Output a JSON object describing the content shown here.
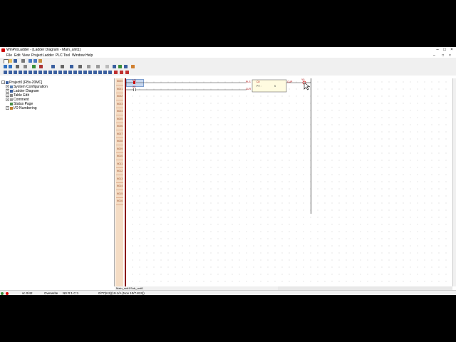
{
  "window": {
    "title": "WinProLadder - [Ladder Diagram - Main_unit1]",
    "controls": [
      "–",
      "□",
      "×"
    ],
    "inner_controls": [
      "–",
      "□",
      "×"
    ]
  },
  "menu": [
    "File",
    "Edit",
    "View",
    "Project",
    "Ladder",
    "PLC",
    "Tool",
    "Window",
    "Help"
  ],
  "tree": {
    "root": "Project0 [FBs-20MC]",
    "items": [
      "System Configuration",
      "Ladder Diagram",
      "Table Edit",
      "Comment",
      "Status Page",
      "I/O Numbering"
    ]
  },
  "rungs": [
    "N000",
    "N001",
    "N002",
    "N003",
    "N004",
    "N005",
    "N006",
    "N007",
    "N008",
    "N009",
    "N010",
    "N011",
    "N012",
    "N013",
    "N014",
    "N015",
    "N016"
  ],
  "ladder": {
    "contact1": "M0",
    "contact2": "X0",
    "block_pin1": "PLS",
    "block_pin2": "CLR",
    "block_top": "C0",
    "block_pv_label": "PV :",
    "block_pv_value": "5",
    "output_pin": "CUP",
    "coil": "Y0"
  },
  "tabs": {
    "main": "Main_unit1",
    "sub": "Sub_unit1"
  },
  "status": {
    "steps": "sc 0/42",
    "mode": "Overwrite",
    "position": "N0 R:1 C:1",
    "info": "0/77(8.2)(19.1/A (Nov 10/7.813))"
  }
}
